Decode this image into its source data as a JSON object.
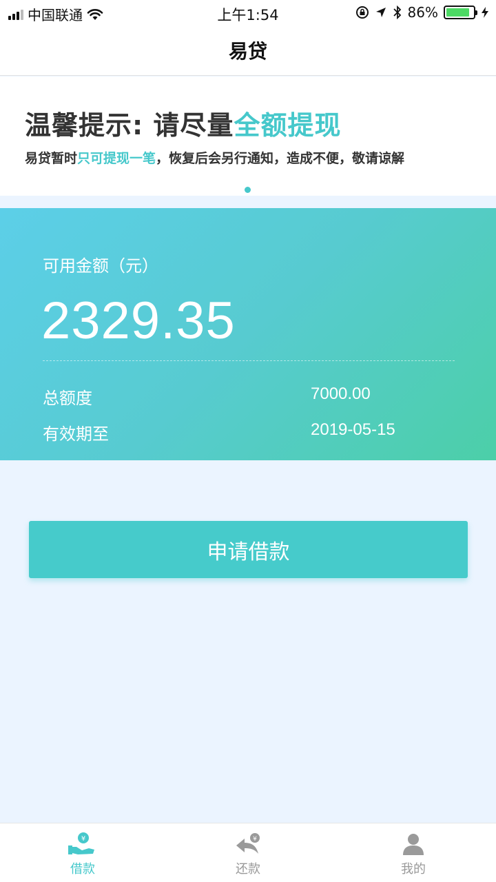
{
  "status_bar": {
    "carrier": "中国联通",
    "time": "上午1:54",
    "battery_percent": "86%",
    "battery_level": 0.86
  },
  "nav": {
    "title": "易贷"
  },
  "banner": {
    "headline_prefix": "温馨提示: 请尽量",
    "headline_highlight": "全额提现",
    "sub_prefix": "易贷暂时",
    "sub_highlight": "只可提现一笔",
    "sub_suffix": "，恢复后会另行通知，造成不便，敬请谅解"
  },
  "card": {
    "available_label": "可用金额（元）",
    "available_amount": "2329.35",
    "total_label": "总额度",
    "total_value": "7000.00",
    "expiry_label": "有效期至",
    "expiry_value": "2019-05-15"
  },
  "apply_button": {
    "label": "申请借款"
  },
  "tabs": [
    {
      "label": "借款",
      "icon": "borrow-icon",
      "active": true
    },
    {
      "label": "还款",
      "icon": "repay-icon",
      "active": false
    },
    {
      "label": "我的",
      "icon": "profile-icon",
      "active": false
    }
  ],
  "colors": {
    "accent": "#46c8cb",
    "background": "#ebf4ff",
    "card_gradient_start": "#5ccfe8",
    "card_gradient_end": "#4ccfa8",
    "inactive_tab": "#999999"
  }
}
